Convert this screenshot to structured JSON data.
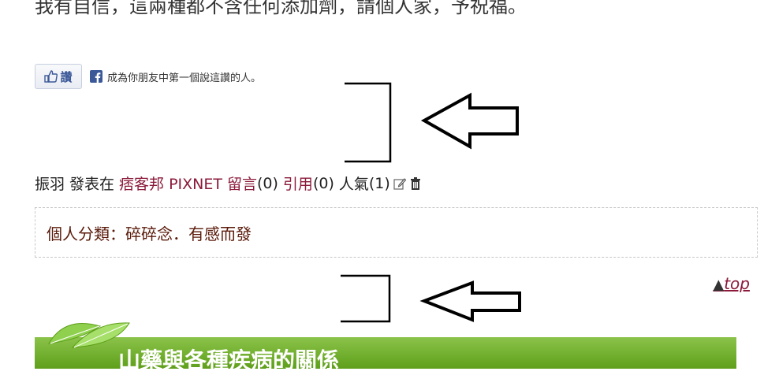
{
  "article": {
    "cut_text": "我有自信，這兩種都不含任何添加劑，請個人家，予祝福。"
  },
  "facebook": {
    "like_label": "讚",
    "social_text": "成為你朋友中第一個說這讚的人。"
  },
  "meta": {
    "author": "振羽",
    "posted_in_label": "發表在",
    "blog_name": "痞客邦 PIXNET",
    "comments_label": "留言",
    "comments_count": "(0)",
    "trackback_label": "引用",
    "trackback_count": "(0)",
    "views_label": "人氣",
    "views_count": "(1)"
  },
  "category": {
    "label": "個人分類：",
    "value": "碎碎念．有感而發"
  },
  "top_link": {
    "arrow": "▲",
    "label": "top"
  },
  "next_post": {
    "title": "山藥與各種疾病的關係"
  },
  "colors": {
    "link": "#8b1a3a",
    "category_text": "#5a1a0a",
    "banner_green": "#6fae22",
    "facebook_blue": "#3b5998"
  }
}
